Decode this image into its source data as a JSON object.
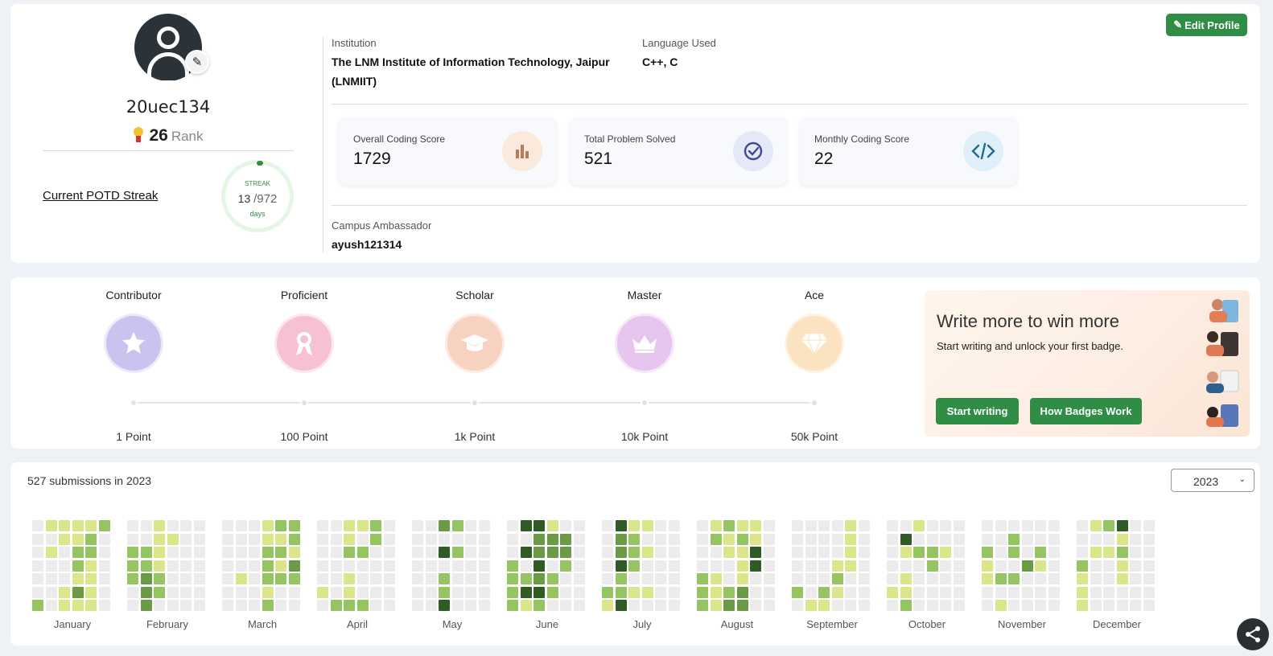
{
  "profile": {
    "username": "20uec134",
    "rank_value": "26",
    "rank_label": "Rank",
    "potd_link": "Current POTD Streak",
    "streak": {
      "title": "STREAK",
      "current": "13",
      "longest": "/972",
      "unit": "days"
    },
    "edit_button": "Edit Profile"
  },
  "info": {
    "institution_label": "Institution",
    "institution_value": "The LNM Institute of Information Technology, Jaipur (LNMIIT)",
    "language_label": "Language Used",
    "language_value": "C++, C",
    "ambassador_label": "Campus Ambassador",
    "ambassador_value": "ayush121314"
  },
  "stats": [
    {
      "label": "Overall Coding Score",
      "value": "1729",
      "icon": "bar-chart-icon",
      "color": "#b87c5a",
      "bg": "#fbe9dc"
    },
    {
      "label": "Total Problem Solved",
      "value": "521",
      "icon": "check-circle-icon",
      "color": "#3e4a8a",
      "bg": "#e4e8f7"
    },
    {
      "label": "Monthly Coding Score",
      "value": "22",
      "icon": "code-icon",
      "color": "#1f6a8f",
      "bg": "#dff0f8"
    }
  ],
  "badges": [
    {
      "name": "Contributor",
      "points": "1 Point",
      "icon": "star-icon",
      "color": "#c9c3ef"
    },
    {
      "name": "Proficient",
      "points": "100 Point",
      "icon": "ribbon-icon",
      "color": "#f6c1d0"
    },
    {
      "name": "Scholar",
      "points": "1k Point",
      "icon": "graduation-cap-icon",
      "color": "#f8d2c1"
    },
    {
      "name": "Master",
      "points": "10k Point",
      "icon": "crown-icon",
      "color": "#e6c5ef"
    },
    {
      "name": "Ace",
      "points": "50k Point",
      "icon": "diamond-icon",
      "color": "#fbe3c1"
    }
  ],
  "promo": {
    "title": "Write more to win more",
    "subtitle": "Start writing and unlock your first badge.",
    "start_button": "Start writing",
    "how_button": "How Badges Work"
  },
  "heatmap": {
    "summary": "527 submissions in 2023",
    "year": "2023",
    "level_colors": [
      "#ececec",
      "#dbe58a",
      "#95c463",
      "#6a9a45",
      "#2f5c25"
    ],
    "months": [
      {
        "name": "January",
        "start": 0,
        "levels": [
          0,
          0,
          0,
          0,
          0,
          0,
          2,
          1,
          0,
          1,
          0,
          0,
          0,
          0,
          1,
          1,
          0,
          0,
          0,
          1,
          1,
          1,
          1,
          2,
          2,
          1,
          3,
          1,
          1,
          2,
          2,
          1,
          1,
          1,
          1,
          2,
          0,
          0,
          0,
          0,
          0,
          0
        ]
      },
      {
        "name": "February",
        "start": 0,
        "levels": [
          0,
          0,
          2,
          2,
          2,
          0,
          0,
          0,
          0,
          2,
          2,
          3,
          3,
          3,
          1,
          1,
          1,
          1,
          2,
          2,
          0,
          0,
          1,
          0,
          0,
          0,
          0,
          0,
          0,
          0,
          0,
          0,
          0,
          0,
          0,
          0,
          0,
          0,
          0,
          0,
          0,
          0
        ]
      },
      {
        "name": "March",
        "start": 0,
        "levels": [
          0,
          0,
          0,
          0,
          0,
          0,
          0,
          0,
          0,
          0,
          0,
          1,
          0,
          0,
          0,
          0,
          0,
          0,
          0,
          0,
          0,
          1,
          1,
          2,
          2,
          2,
          1,
          2,
          2,
          1,
          2,
          1,
          2,
          0,
          0,
          2,
          2,
          1,
          3,
          2,
          0,
          0
        ]
      },
      {
        "name": "April",
        "start": 0,
        "levels": [
          0,
          0,
          0,
          0,
          0,
          1,
          0,
          0,
          0,
          0,
          0,
          0,
          0,
          2,
          1,
          1,
          2,
          0,
          1,
          1,
          2,
          1,
          0,
          2,
          0,
          0,
          0,
          2,
          2,
          2,
          0,
          0,
          0,
          0,
          0,
          0,
          0,
          0,
          0,
          0,
          0,
          0
        ]
      },
      {
        "name": "May",
        "start": 0,
        "levels": [
          0,
          0,
          0,
          0,
          0,
          0,
          0,
          0,
          0,
          0,
          0,
          0,
          0,
          0,
          3,
          0,
          4,
          0,
          2,
          2,
          4,
          2,
          0,
          2,
          0,
          0,
          0,
          0,
          0,
          0,
          0,
          0,
          0,
          0,
          0,
          0,
          0,
          0,
          0,
          0,
          0,
          0
        ]
      },
      {
        "name": "June",
        "start": 0,
        "levels": [
          0,
          0,
          0,
          2,
          2,
          2,
          2,
          4,
          0,
          4,
          0,
          2,
          4,
          1,
          4,
          3,
          3,
          4,
          3,
          4,
          2,
          1,
          3,
          3,
          0,
          2,
          2,
          0,
          0,
          3,
          3,
          2,
          0,
          0,
          0,
          0,
          0,
          0,
          0,
          0,
          0,
          0
        ]
      },
      {
        "name": "July",
        "start": 0,
        "levels": [
          0,
          0,
          0,
          0,
          0,
          2,
          1,
          4,
          3,
          3,
          4,
          2,
          2,
          4,
          1,
          2,
          2,
          2,
          0,
          1,
          0,
          1,
          0,
          1,
          0,
          0,
          1,
          0,
          0,
          0,
          0,
          0,
          0,
          0,
          0,
          0,
          0,
          0,
          0,
          0,
          0,
          0
        ]
      },
      {
        "name": "August",
        "start": 0,
        "levels": [
          0,
          0,
          0,
          0,
          2,
          2,
          2,
          1,
          2,
          0,
          0,
          1,
          1,
          1,
          2,
          1,
          1,
          0,
          0,
          2,
          3,
          1,
          2,
          1,
          1,
          1,
          3,
          3,
          1,
          1,
          4,
          4,
          0,
          0,
          0,
          0,
          0,
          0,
          0,
          0,
          0,
          0
        ]
      },
      {
        "name": "September",
        "start": 0,
        "levels": [
          0,
          0,
          0,
          0,
          0,
          2,
          0,
          0,
          0,
          0,
          0,
          0,
          0,
          1,
          0,
          0,
          0,
          0,
          0,
          2,
          1,
          0,
          0,
          0,
          1,
          2,
          1,
          0,
          1,
          1,
          1,
          1,
          0,
          0,
          0,
          0,
          0,
          0,
          0,
          0,
          0,
          0
        ]
      },
      {
        "name": "October",
        "start": 0,
        "levels": [
          0,
          0,
          0,
          0,
          0,
          1,
          0,
          0,
          4,
          1,
          0,
          1,
          1,
          2,
          1,
          0,
          2,
          0,
          0,
          0,
          0,
          0,
          0,
          2,
          2,
          0,
          0,
          0,
          0,
          0,
          1,
          0,
          0,
          0,
          0,
          0,
          0,
          0,
          0,
          0,
          0,
          0
        ]
      },
      {
        "name": "November",
        "start": 0,
        "levels": [
          0,
          0,
          2,
          1,
          1,
          0,
          0,
          0,
          0,
          0,
          0,
          2,
          0,
          1,
          0,
          2,
          2,
          0,
          2,
          0,
          0,
          0,
          0,
          0,
          3,
          0,
          0,
          0,
          0,
          0,
          2,
          1,
          0,
          0,
          0,
          0,
          0,
          0,
          0,
          0,
          0,
          0
        ]
      },
      {
        "name": "December",
        "start": 0,
        "levels": [
          0,
          0,
          0,
          2,
          1,
          1,
          1,
          1,
          0,
          1,
          0,
          0,
          0,
          0,
          2,
          0,
          1,
          0,
          0,
          0,
          0,
          4,
          1,
          2,
          1,
          1,
          0,
          0,
          0,
          0,
          0,
          0,
          0,
          0,
          0,
          0,
          0,
          0,
          0,
          0,
          0,
          0
        ]
      }
    ]
  }
}
